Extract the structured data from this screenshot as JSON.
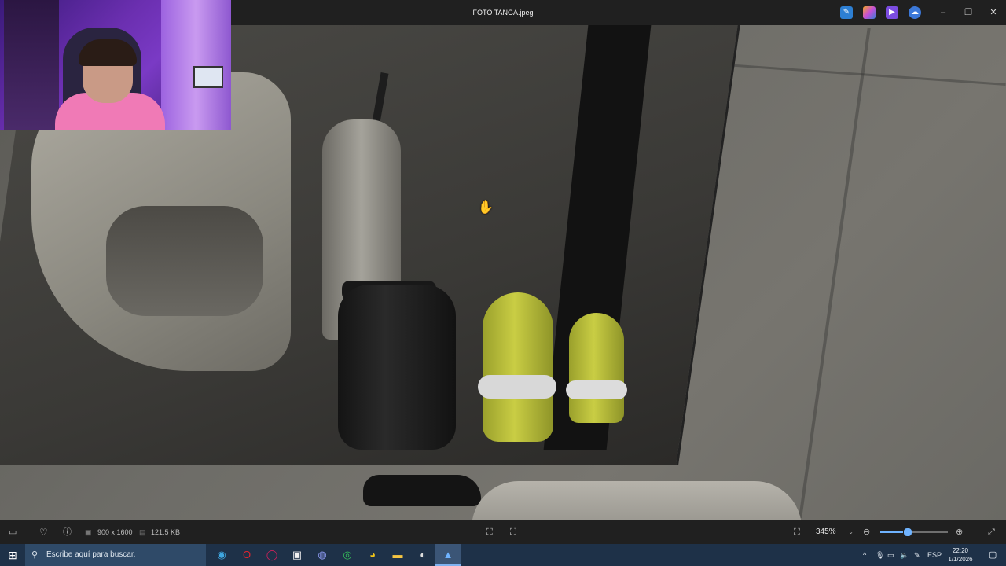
{
  "window": {
    "title": "FOTO TANGA.jpeg"
  },
  "titlebar_icons": [
    "image-edit-icon",
    "copilot-icon",
    "clipchamp-icon",
    "onedrive-icon"
  ],
  "window_controls": {
    "minimize": "–",
    "maximize": "❐",
    "close": "✕"
  },
  "bottom_bar": {
    "dimensions": "900 x 1600",
    "file_size": "121.5 KB",
    "zoom": "345%",
    "zoom_level_fraction": 0.4
  },
  "taskbar": {
    "search_placeholder": "Escribe aquí para buscar.",
    "apps": [
      "edge-icon",
      "opera-icon",
      "opera-gx-icon",
      "store-icon",
      "discord-icon",
      "whatsapp-icon",
      "chrome-icon",
      "file-explorer-icon",
      "obs-icon",
      "photos-icon"
    ],
    "active_app": "photos-icon",
    "language": "ESP",
    "time": "22:20",
    "date": "1/1/2026"
  },
  "colors": {
    "accent": "#6fb3ff",
    "titlebar": "#202020",
    "taskbar": "#1e3148"
  }
}
